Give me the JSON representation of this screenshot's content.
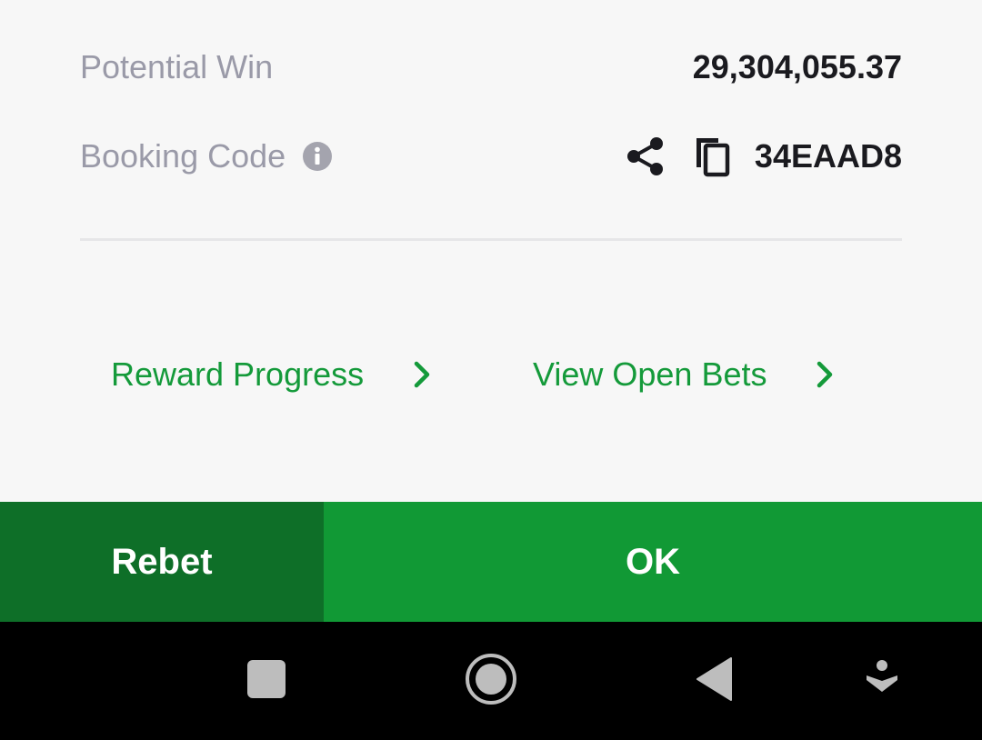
{
  "summary": {
    "potential_win_label": "Potential Win",
    "potential_win_value": "29,304,055.37",
    "booking_code_label": "Booking Code",
    "booking_code_value": "34EAAD8"
  },
  "links": {
    "reward_progress": "Reward Progress",
    "view_open_bets": "View Open Bets"
  },
  "actions": {
    "rebet_label": "Rebet",
    "ok_label": "OK"
  },
  "icons": {
    "info": "info-icon",
    "share": "share-icon",
    "copy": "copy-icon",
    "chevron": "chevron-right-icon",
    "recents": "square-icon",
    "home": "circle-icon",
    "back": "triangle-back-icon",
    "extra": "accessibility-icon"
  },
  "colors": {
    "accent_green": "#119935",
    "dark_green": "#0e6f28",
    "label_gray": "#9a9aa8",
    "value_dark": "#1a1a1f"
  }
}
